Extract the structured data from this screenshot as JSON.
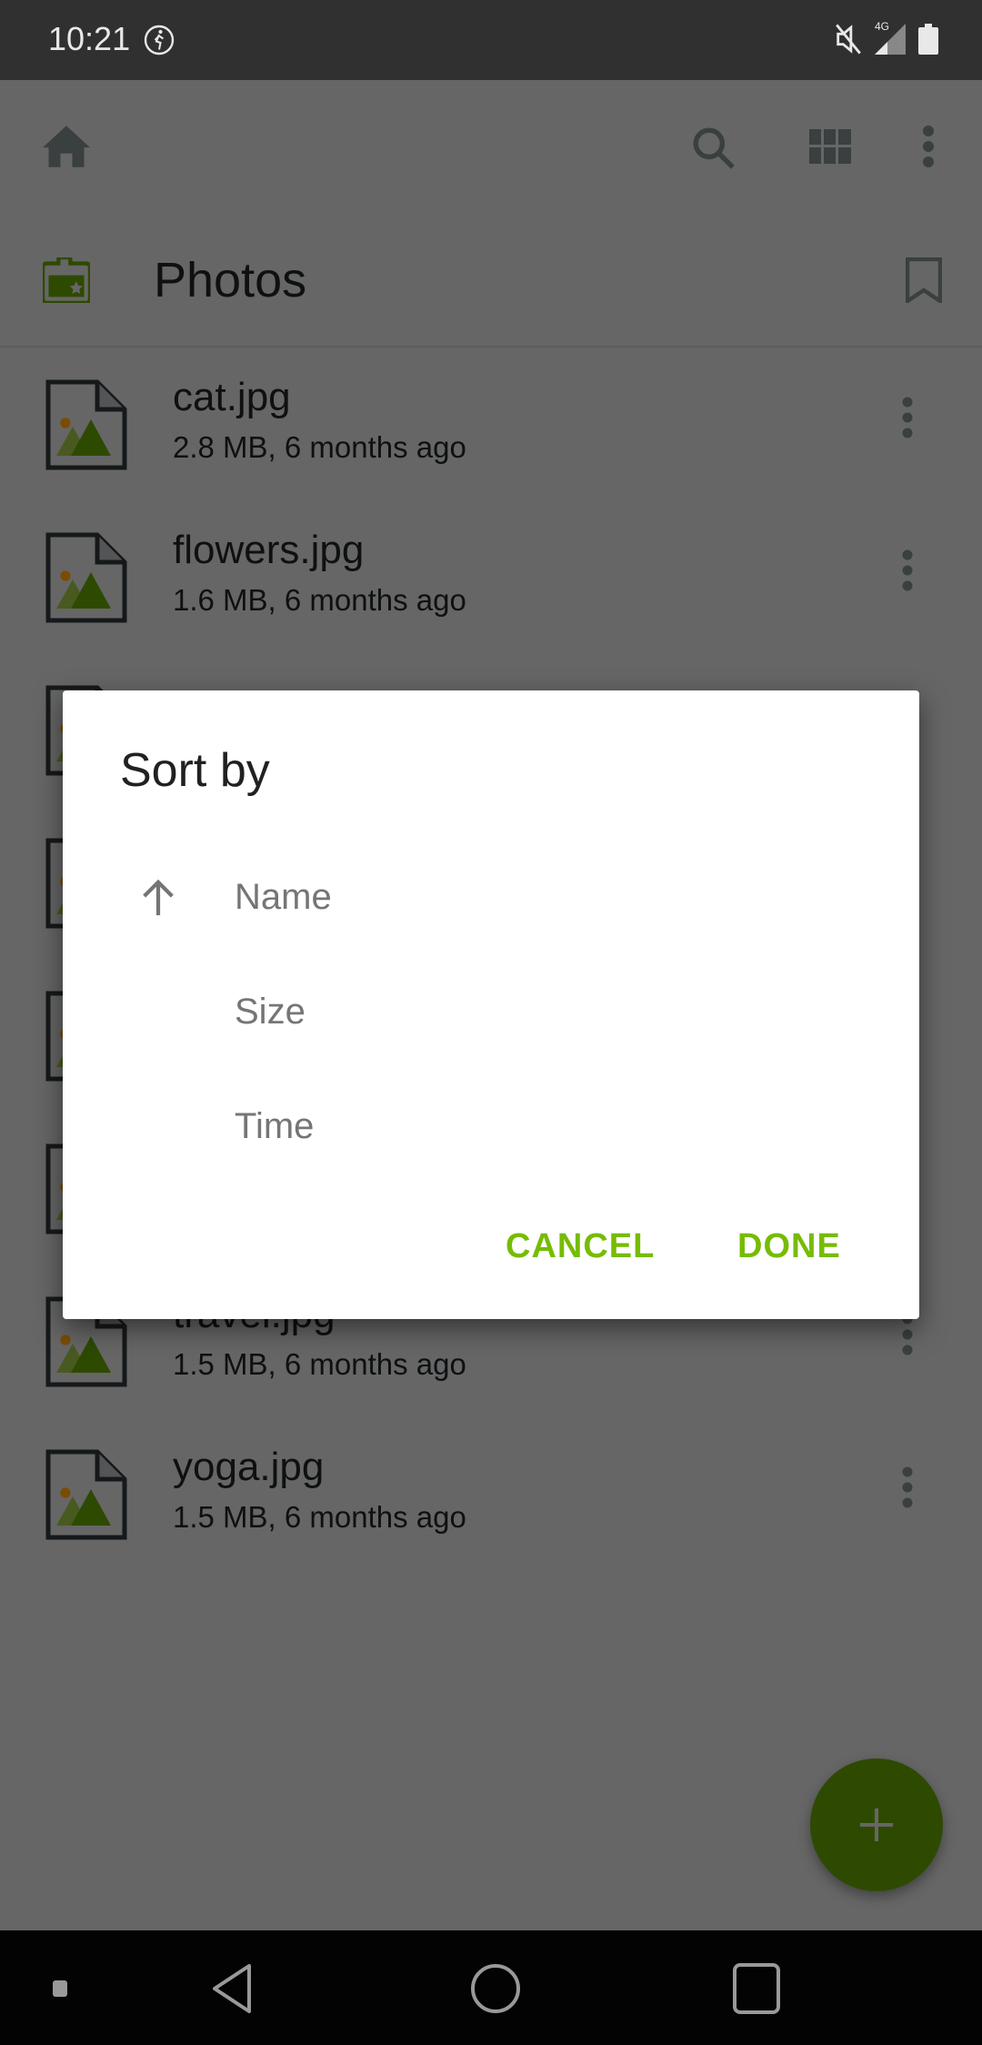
{
  "status_bar": {
    "time": "10:21",
    "icons": [
      "activity-icon",
      "mute-icon",
      "signal-4g-icon",
      "battery-icon"
    ],
    "network_label": "4G"
  },
  "toolbar": {
    "icons": [
      "home-icon",
      "search-icon",
      "grid-view-icon",
      "more-vert-icon"
    ]
  },
  "folder": {
    "title": "Photos",
    "icon": "folder-star-icon",
    "bookmark_icon": "bookmark-icon"
  },
  "files": [
    {
      "name": "cat.jpg",
      "meta": "2.8 MB, 6 months ago"
    },
    {
      "name": "flowers.jpg",
      "meta": "1.6 MB, 6 months ago"
    },
    {
      "name": "",
      "meta": ""
    },
    {
      "name": "",
      "meta": ""
    },
    {
      "name": "",
      "meta": ""
    },
    {
      "name": "",
      "meta": ""
    },
    {
      "name": "travel.jpg",
      "meta": "1.5 MB, 6 months ago"
    },
    {
      "name": "yoga.jpg",
      "meta": "1.5 MB, 6 months ago"
    }
  ],
  "dialog": {
    "title": "Sort by",
    "options": [
      {
        "label": "Name",
        "selected": true,
        "direction": "ascending"
      },
      {
        "label": "Size",
        "selected": false
      },
      {
        "label": "Time",
        "selected": false
      }
    ],
    "cancel_label": "CANCEL",
    "done_label": "DONE"
  },
  "colors": {
    "accent": "#76bc00",
    "status_bar": "#303030",
    "nav_bar": "#030303"
  }
}
